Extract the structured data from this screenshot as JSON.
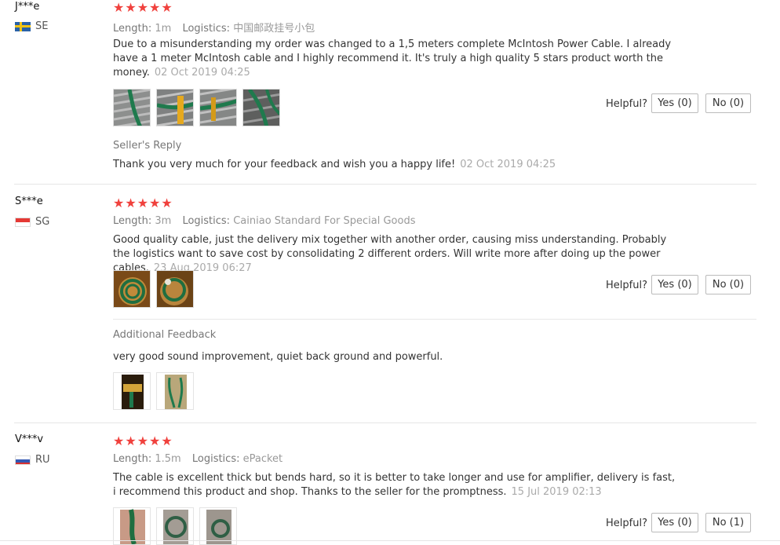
{
  "reviews": [
    {
      "user": "J***e",
      "country": "SE",
      "length_label": "Length:",
      "length": "1m",
      "logistics_label": "Logistics:",
      "logistics": "中国邮政挂号小包",
      "text": "Due to a misunderstanding my order was changed to a 1,5 meters complete McIntosh Power Cable. I already have a 1 meter McIntosh cable and I highly recommend it. It's truly a high quality 5 stars product worth the money.",
      "date": "02 Oct 2019 04:25",
      "stars": 5,
      "helpful_label": "Helpful?",
      "yes": "Yes (0)",
      "no": "No (0)",
      "seller_reply_label": "Seller's Reply",
      "seller_reply": "Thank you very much for your feedback and wish you a happy life!",
      "seller_reply_date": "02 Oct 2019 04:25"
    },
    {
      "user": "S***e",
      "country": "SG",
      "length_label": "Length:",
      "length": "3m",
      "logistics_label": "Logistics:",
      "logistics": "Cainiao Standard For Special Goods",
      "text": "Good quality cable, just the delivery mix together with another order, causing miss understanding. Probably the logistics want to save cost by consolidating 2 different orders. Will write more after doing up the power cables.",
      "date": "23 Aug 2019 06:27",
      "stars": 5,
      "helpful_label": "Helpful?",
      "yes": "Yes (0)",
      "no": "No (0)",
      "additional_label": "Additional Feedback",
      "additional": "very good sound improvement, quiet back ground and powerful."
    },
    {
      "user": "V***v",
      "country": "RU",
      "length_label": "Length:",
      "length": "1.5m",
      "logistics_label": "Logistics:",
      "logistics": "ePacket",
      "text": "The cable is excellent thick but bends hard, so it is better to take longer and use for amplifier, delivery is fast, i recommend this product and shop. Thanks to the seller for the promptness.",
      "date": "15 Jul 2019 02:13",
      "stars": 5,
      "helpful_label": "Helpful?",
      "yes": "Yes (0)",
      "no": "No (1)"
    }
  ],
  "colors": {
    "star": "#f0413d",
    "muted": "#999999"
  },
  "icons": {
    "star": "star-icon"
  }
}
